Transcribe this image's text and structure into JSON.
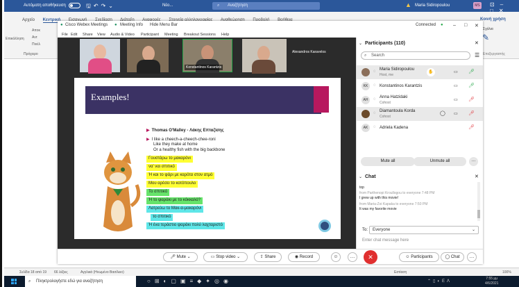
{
  "word": {
    "autosave_label": "Αυτόματη αποθήκευση",
    "doc_title": "Νέο...",
    "search_placeholder": "Αναζήτηση",
    "user_name": "Maria Sidiropoulou",
    "user_initials": "MS",
    "tabs": [
      "Αρχείο",
      "Κεντρική",
      "Εισαγωγή",
      "Σχεδίαση",
      "Διάταξη",
      "Αναφορές",
      "Στοιχεία αλληλογραφίας",
      "Αναθεώρηση",
      "Προβολή",
      "Βοήθεια"
    ],
    "ribbon_left": [
      "Επικόλληση",
      "Αποκ",
      "Αντ",
      "Πινέλ",
      "Πρόχειρο"
    ],
    "share_label": "Κοινή χρήση",
    "comments_label": "Σχόλια",
    "editor_label": "Επεξεργαστής",
    "status_page": "Σελίδα 18 από 19",
    "status_words": "66 λέξεις",
    "status_lang": "Αγγλικά (Ηνωμένο Βασίλειο)",
    "status_focus": "Εστίαση",
    "status_zoom": "100%"
  },
  "webex": {
    "app_name": "Cisco Webex Meetings",
    "meeting_info": "Meeting Info",
    "hide_menu": "Hide Menu Bar",
    "connected": "Connected",
    "menu": [
      "File",
      "Edit",
      "Share",
      "View",
      "Audio & Video",
      "Participant",
      "Meeting",
      "Breakout Sessions",
      "Help"
    ],
    "thumbs": [
      {
        "name": ""
      },
      {
        "name": ""
      },
      {
        "name": "Konstantinos Karantzis"
      },
      {
        "name": ""
      }
    ],
    "active_speaker": "Alexandros Karavelos",
    "slide": {
      "title": "Examples!",
      "bullet1": "Thomas O'Malley - Λάκης Επταζίσης",
      "bullet2": "I like a cheech-a-cheech-chee-roni",
      "line2": "Like they make at home",
      "line3": "Or a healthy fish with the big backbone",
      "highlights": [
        {
          "text": "Γουστάρω το μακαρόνι",
          "color": "y"
        },
        {
          "text": "να' ναι σπιτικό",
          "color": "y"
        },
        {
          "text": "Ή και το ψάρι με καρότα στον ατμό",
          "color": "y"
        },
        {
          "text": "Μου αρέσει το κοτόπουλο",
          "color": "y"
        },
        {
          "text": "Το σπιτικό",
          "color": "g"
        },
        {
          "text": "Ή το ψαράκι με το κόκκαλό?",
          "color": "g"
        },
        {
          "text": "Λατρεύω το Μακ-α-μακαρόνι",
          "color": "c"
        },
        {
          "text": "το σπιτικό",
          "color": "c"
        },
        {
          "text": "Ή ένα τεράστιο ψαράκι πολύ λαχταριστό",
          "color": "c"
        }
      ]
    },
    "participants": {
      "header": "Participants (110)",
      "search_placeholder": "Search",
      "list": [
        {
          "initials": "",
          "name": "Maria Sidiropoulou",
          "role": "Host, me",
          "mic": "on"
        },
        {
          "initials": "KK",
          "name": "Konstantinos Karantzis",
          "role": "",
          "mic": "on"
        },
        {
          "initials": "AH",
          "name": "Anna Hatzidaki",
          "role": "Cohost",
          "mic": "off"
        },
        {
          "initials": "",
          "name": "Diamantoula Korda",
          "role": "Cohost",
          "mic": "off"
        },
        {
          "initials": "AK",
          "name": "Adriela Kadena",
          "role": "",
          "mic": "off"
        }
      ],
      "mute_all": "Mute all",
      "unmute_all": "Unmute all"
    },
    "chat": {
      "header": "Chat",
      "messages": [
        {
          "meta": "",
          "text": "top"
        },
        {
          "meta": "from Parthenopi Kroullogou to everyone   7:48 PM",
          "text": "I grew up with this movie!"
        },
        {
          "meta": "from Maria-Zoi Kapaka to everyone   7:50 PM",
          "text": "It was my favorite movie"
        }
      ],
      "to_label": "To:",
      "to_value": "Everyone",
      "input_placeholder": "Enter chat message here"
    },
    "controls": {
      "mute": "Mute",
      "stop_video": "Stop video",
      "share": "Share",
      "record": "Record",
      "participants": "Participants",
      "chat": "Chat"
    }
  },
  "taskbar": {
    "search_placeholder": "Πληκτρολογήστε εδώ για αναζήτηση",
    "time": "7:55 μμ",
    "date": "4/6/2021"
  },
  "colors": {
    "word_blue": "#2b579a",
    "slide_banner": "#3b3264",
    "slide_accent": "#b7185e",
    "leave_red": "#e02f2f",
    "mic_on": "#27a84a",
    "mic_off": "#e0383e"
  }
}
